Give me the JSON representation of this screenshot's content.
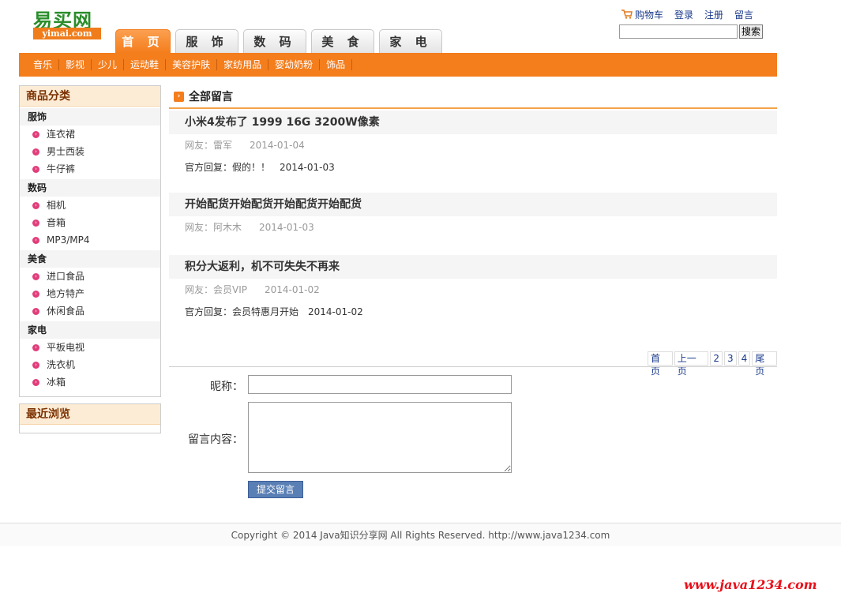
{
  "logo": {
    "cn": "易买网",
    "en": "yimai.com"
  },
  "toplinks": {
    "cart": "购物车",
    "login": "登录",
    "register": "注册",
    "message": "留言"
  },
  "search": {
    "placeholder": "",
    "button": "搜索"
  },
  "navtabs": [
    "首 页",
    "服 饰",
    "数 码",
    "美 食",
    "家 电"
  ],
  "subnav": [
    "音乐",
    "影视",
    "少儿",
    "运动鞋",
    "美容护肤",
    "家纺用品",
    "婴幼奶粉",
    "饰品"
  ],
  "sidebar": {
    "category_title": "商品分类",
    "groups": [
      {
        "name": "服饰",
        "items": [
          "连衣裙",
          "男士西装",
          "牛仔裤"
        ]
      },
      {
        "name": "数码",
        "items": [
          "相机",
          "音箱",
          "MP3/MP4"
        ]
      },
      {
        "name": "美食",
        "items": [
          "进口食品",
          "地方特产",
          "休闲食品"
        ]
      },
      {
        "name": "家电",
        "items": [
          "平板电视",
          "洗衣机",
          "冰箱"
        ]
      }
    ],
    "recent_title": "最近浏览"
  },
  "main": {
    "title": "全部留言",
    "messages": [
      {
        "title": "小米4发布了 1999 16G 3200W像素",
        "user": "网友：雷军",
        "user_date": "2014-01-04",
        "reply": "官方回复：假的！！",
        "reply_date": "2014-01-03"
      },
      {
        "title": "开始配货开始配货开始配货开始配货",
        "user": "网友：阿木木",
        "user_date": "2014-01-03"
      },
      {
        "title": "积分大返利，机不可失失不再来",
        "user": "网友：会员VIP",
        "user_date": "2014-01-02",
        "reply": "官方回复：会员特惠月开始",
        "reply_date": "2014-01-02"
      }
    ],
    "pager": [
      "首页",
      "上一页",
      "2",
      "3",
      "4",
      "尾页"
    ]
  },
  "form": {
    "nickname_label": "昵称：",
    "content_label": "留言内容：",
    "nickname_value": "",
    "content_value": "",
    "submit": "提交留言"
  },
  "footer": "Copyright © 2014 Java知识分享网 All Rights Reserved. http://www.java1234.com",
  "watermark": "www.java1234.com",
  "colors": {
    "accent": "#f47d1c",
    "link": "#1a3a8a",
    "bullet": "#e23c7a"
  }
}
